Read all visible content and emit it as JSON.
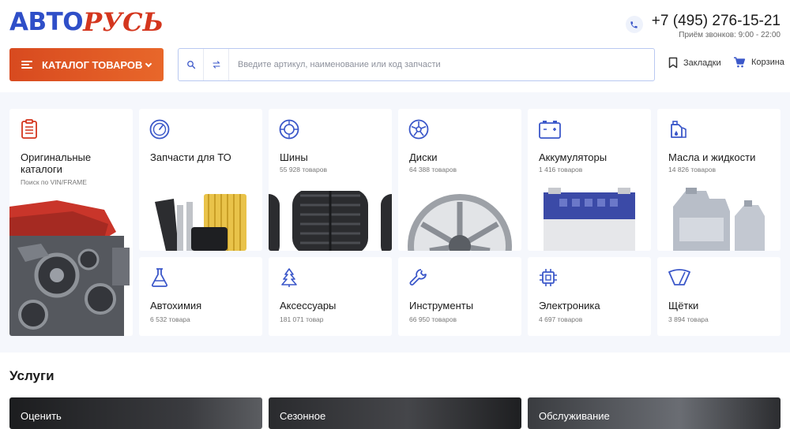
{
  "header": {
    "logo_left": "АВТО",
    "logo_right": "РУСЬ",
    "phone": "+7 (495) 276-15-21",
    "phone_note": "Приём звонков: 9:00 - 22:00",
    "catalog_label": "КАТАЛОГ ТОВАРОВ",
    "search_placeholder": "Введите артикул, наименование или код запчасти",
    "bookmarks": "Закладки",
    "cart": "Корзина"
  },
  "colors": {
    "brand_blue": "#2f4fc8",
    "brand_red": "#d4361e",
    "accent_orange": "#e05525"
  },
  "categories": [
    {
      "title": "Оригинальные каталоги",
      "subtitle": "Поиск по VIN/FRAME",
      "icon": "catalog-list-icon"
    },
    {
      "title": "Запчасти для ТО",
      "subtitle": "",
      "icon": "gauge-icon"
    },
    {
      "title": "Шины",
      "subtitle": "55 928 товаров",
      "icon": "tire-icon"
    },
    {
      "title": "Диски",
      "subtitle": "64 388 товаров",
      "icon": "rim-icon"
    },
    {
      "title": "Аккумуляторы",
      "subtitle": "1 416 товаров",
      "icon": "battery-icon"
    },
    {
      "title": "Масла и жидкости",
      "subtitle": "14 826 товаров",
      "icon": "oil-can-icon"
    },
    {
      "title": "Автохимия",
      "subtitle": "6 532 товара",
      "icon": "flask-icon"
    },
    {
      "title": "Аксессуары",
      "subtitle": "181 071 товар",
      "icon": "air-freshener-icon"
    },
    {
      "title": "Инструменты",
      "subtitle": "66 950 товаров",
      "icon": "wrench-icon"
    },
    {
      "title": "Электроника",
      "subtitle": "4 697 товаров",
      "icon": "chip-icon"
    },
    {
      "title": "Щётки",
      "subtitle": "3 894 товара",
      "icon": "wiper-icon"
    }
  ],
  "services": {
    "title": "Услуги",
    "items": [
      {
        "label": "Оценить"
      },
      {
        "label": "Сезонное"
      },
      {
        "label": "Обслуживание"
      }
    ]
  }
}
